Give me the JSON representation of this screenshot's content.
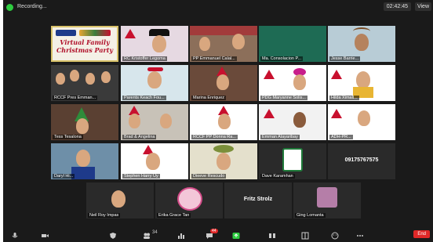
{
  "topbar": {
    "recording_label": "Recording...",
    "time": "02:42:45",
    "view_label": "View"
  },
  "banner": {
    "line1": "Virtual Family",
    "line2": "Christmas Party"
  },
  "participants": [
    "RC Kristoffer Legoma",
    "PP Emmanuel Calal...",
    "Ma. Consolacion P...",
    "Jesse Barrie...",
    "RCCF Pres Emman...",
    "Parents Keach Fou...",
    "Marina Enriquez",
    "PDG Maryanne Solis...",
    "Hilda Ximall...",
    "Tess Tesalona",
    "Brad & Angelina",
    "RCCF PP Donna Ra...",
    "Emman Alayaribay",
    "ADH-PR...",
    "Daryl Hi...",
    "Stephen Harry Uy",
    "Dieeve Rescudo",
    "Dave Karamhan",
    "Neil Roy Impas",
    "Erika Grace Tan",
    "Fritz Strolz",
    "Ging Lomanta"
  ],
  "phone_tile": {
    "text": "09175767575"
  },
  "fritz_tile": {
    "text": "Fritz Strolz"
  },
  "toolbar": {
    "items": [
      {
        "label": "Unmute",
        "icon": "mic-icon"
      },
      {
        "label": "Start Video",
        "icon": "video-icon"
      },
      {
        "label": "Security",
        "icon": "shield-icon"
      },
      {
        "label": "Participants",
        "icon": "people-icon",
        "count": "34"
      },
      {
        "label": "Polls",
        "icon": "bar-chart-icon"
      },
      {
        "label": "Chat",
        "icon": "chat-icon",
        "badge": "44"
      },
      {
        "label": "Share Screen",
        "icon": "share-screen-icon"
      },
      {
        "label": "Pause/Stop Recording",
        "icon": "record-icon"
      },
      {
        "label": "Breakout Rooms",
        "icon": "breakout-icon"
      },
      {
        "label": "Reactions",
        "icon": "smile-icon"
      },
      {
        "label": "More",
        "icon": "more-icon"
      }
    ],
    "end_label": "End"
  },
  "colors": {
    "accent_red": "#e02828",
    "green": "#2ecc40",
    "background": "#1a1a1a"
  }
}
